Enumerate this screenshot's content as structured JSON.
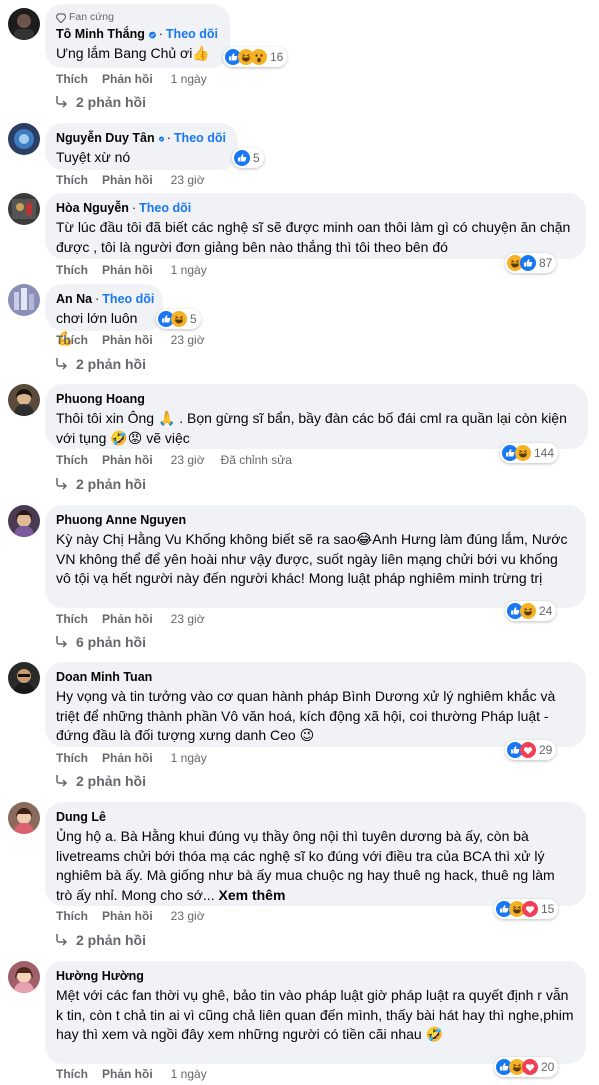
{
  "ui": {
    "follow": "Theo dõi",
    "like": "Thích",
    "reply": "Phản hồi",
    "see_more": "Xem thêm",
    "fan_badge": "Fan cứng",
    "edited": "Đã chỉnh sửa"
  },
  "comments": [
    {
      "name": "Tô Minh Thắng",
      "badge": "Fan cứng",
      "verified": true,
      "follow": true,
      "text": "Ưng lắm Bang Chủ ơi👍",
      "reactions": [
        "like",
        "haha",
        "wow"
      ],
      "react_count": "16",
      "time": "1 ngày",
      "replies": "2 phản hồi",
      "avatar_color": "#1c1c1c"
    },
    {
      "name": "Nguyễn Duy Tân",
      "verified": true,
      "follow": true,
      "text": "Tuyệt xừ nó",
      "reactions": [
        "like"
      ],
      "react_count": "5",
      "time": "23 giờ",
      "avatar_color": "#2c3e64"
    },
    {
      "name": "Hòa Nguyễn",
      "verified": false,
      "follow": true,
      "text": "Từ lúc đầu tôi đã biết các nghệ sĩ sẽ được minh oan thôi làm gì có chuyện ăn chặn được , tôi là người đơn giảng bên nào thắng thì tôi theo bên đó",
      "reactions": [
        "haha",
        "like"
      ],
      "react_count": "87",
      "time": "1 ngày",
      "avatar_color": "#3b3b3b"
    },
    {
      "name": "An Na",
      "verified": false,
      "follow": true,
      "text": "chơi lớn luôn💪",
      "reactions": [
        "like",
        "haha"
      ],
      "react_count": "5",
      "time": "23 giờ",
      "replies": "2 phản hồi",
      "avatar_color": "#8b8fb5"
    },
    {
      "name": "Phuong Hoang",
      "verified": false,
      "follow": false,
      "text": "Thôi tôi xin Ông 🙏 . Bọn gừng sĩ bẩn, bầy đàn các bố đái cml ra quần lại còn kiện với tụng 🤣😡 vẽ việc",
      "reactions": [
        "like",
        "haha"
      ],
      "react_count": "144",
      "time": "23 giờ",
      "edited": true,
      "replies": "2 phản hồi",
      "avatar_color": "#5a4a3a"
    },
    {
      "name": "Phuong Anne Nguyen",
      "verified": false,
      "follow": false,
      "text": "Kỳ này Chị Hằng Vu Khống không biết sẽ ra sao😂Anh Hưng làm đúng lắm, Nước VN không thể để yên hoài như vậy được, suốt ngày liên mạng chửi bới vu khống vô tội vạ hết người này đến người khác! Mong luật pháp nghiêm minh trừng trị",
      "reactions": [
        "like",
        "haha"
      ],
      "react_count": "24",
      "time": "23 giờ",
      "replies": "6 phản hồi",
      "avatar_color": "#4a3a52"
    },
    {
      "name": "Doan Minh Tuan",
      "verified": false,
      "follow": false,
      "text": "Hy vọng và tin tưởng vào cơ quan hành pháp Bình Dương xử lý nghiêm khắc và triệt để những thành phần Vô văn hoá, kích động xã hội, coi thường Pháp luật - đứng đầu là đối tượng xưng danh Ceo 😉",
      "reactions": [
        "like",
        "love"
      ],
      "react_count": "29",
      "time": "1 ngày",
      "replies": "2 phản hồi",
      "avatar_color": "#2a2a2a"
    },
    {
      "name": "Dung Lê",
      "verified": false,
      "follow": false,
      "text": "Ủng hộ a. Bà Hằng khui đúng vụ thầy ông nội thì tuyên dương bà ấy, còn bà livetreams chửi bới thóa mạ các nghệ sĩ ko đúng với điều tra của BCA thì xử lý nghiêm bà ấy. Mà giống như bà ấy mua chuộc ng hay thuê ng hack, thuê ng làm trò ấy nhỉ. Mong cho sớ...",
      "see_more": true,
      "reactions": [
        "like",
        "haha",
        "love"
      ],
      "react_count": "15",
      "time": "23 giờ",
      "replies": "2 phản hồi",
      "avatar_color": "#8a6a5a"
    },
    {
      "name": "Hường Hường",
      "verified": false,
      "follow": false,
      "text": "Mệt với các fan thời vụ ghê, bảo tin vào pháp luật giờ pháp luật ra quyết định r vẫn k tin, còn t chả tin ai vì cũng chả liên quan đến mình, thấy bài hát hay thì nghe,phim hay thì xem và ngồi đây xem những người có tiền cãi nhau 🤣",
      "reactions": [
        "like",
        "haha",
        "love"
      ],
      "react_count": "20",
      "time": "1 ngày",
      "avatar_color": "#a0606a"
    }
  ]
}
